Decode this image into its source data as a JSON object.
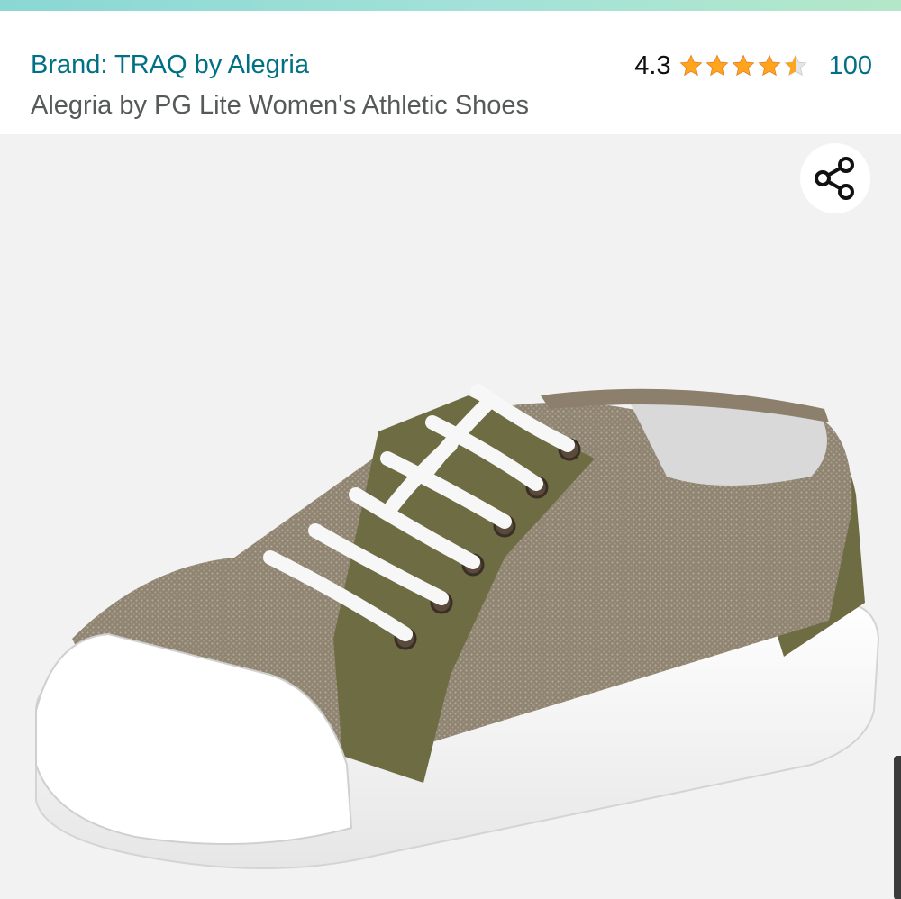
{
  "header": {
    "brand": "Brand: TRAQ by Alegria",
    "title": "Alegria by PG Lite Women's Athletic Shoes",
    "rating_value": "4.3",
    "rating_stars": 4.3,
    "rating_max": 5,
    "review_count": "100"
  },
  "image": {
    "subject": "shoe",
    "share_icon": "share-icon"
  },
  "colors": {
    "link": "#007185",
    "star": "#ffa41c",
    "text_muted": "#565959",
    "image_bg": "#f2f2f2"
  }
}
